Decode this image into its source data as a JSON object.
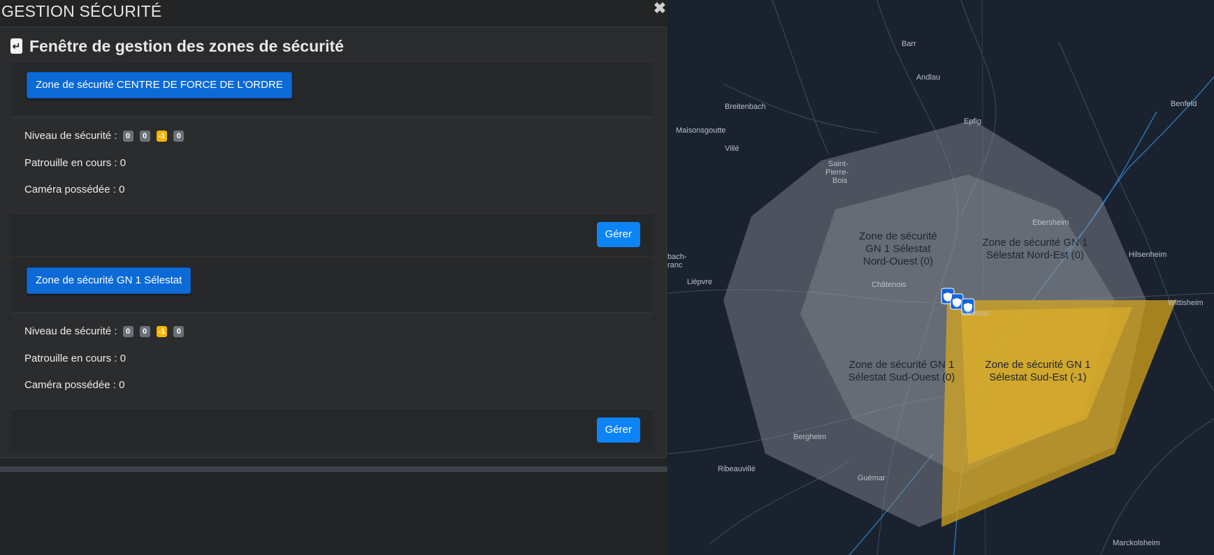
{
  "app": {
    "title": "GESTION SÉCURITÉ",
    "close_symbol": "✖"
  },
  "panel": {
    "back_symbol": "↵",
    "title": "Fenêtre de gestion des zones de sécurité",
    "zones": [
      {
        "name": "Zone de sécurité CENTRE DE FORCE DE L'ORDRE",
        "security_label": "Niveau de sécurité :",
        "levels": [
          "0",
          "0",
          "-1",
          "0"
        ],
        "patrol": "Patrouille en cours : 0",
        "camera": "Caméra possédée : 0",
        "manage": "Gérer"
      },
      {
        "name": "Zone de sécurité GN 1 Sélestat",
        "security_label": "Niveau de sécurité :",
        "levels": [
          "0",
          "0",
          "-1",
          "0"
        ],
        "patrol": "Patrouille en cours : 0",
        "camera": "Caméra possédée : 0",
        "manage": "Gérer"
      }
    ]
  },
  "map": {
    "places": {
      "barr": "Barr",
      "andlau": "Andlau",
      "breitenbach": "Breitenbach",
      "maisonsgoutte": "Maisonsgoutte",
      "epfig": "Epfig",
      "ville": "Villé",
      "saint1": "Saint-",
      "saint2": "Pierre-",
      "saint3": "Bois",
      "benfeld": "Benfeld",
      "ebersheim": "Ebersheim",
      "hilsenheim": "Hilsenheim",
      "lievre": "Lièpvre",
      "chatenois": "Châtenois",
      "selestat": "Sélestat",
      "wittisheim": "Wittisheim",
      "bergheim": "Bergheim",
      "ribeauville": "Ribeauvillé",
      "guemar": "Guémar",
      "marckolsheim": "Marckolsheim",
      "bach": "bach-",
      "ranc": "ranc"
    },
    "zones": {
      "nw": [
        "Zone de sécurité",
        "GN 1 Sélestat",
        "Nord-Ouest (0)"
      ],
      "ne": [
        "Zone de sécurité GN 1",
        "Sélestat Nord-Est (0)"
      ],
      "sw": [
        "Zone de sécurité GN 1",
        "Sélestat Sud-Ouest (0)"
      ],
      "se": [
        "Zone de sécurité GN 1",
        "Sélestat Sud-Est (-1)"
      ]
    },
    "colors": {
      "background": "#1a2230",
      "zone_gray": "#8a8f97",
      "zone_alert": "#d9a81a",
      "marker": "#1565d8"
    }
  }
}
